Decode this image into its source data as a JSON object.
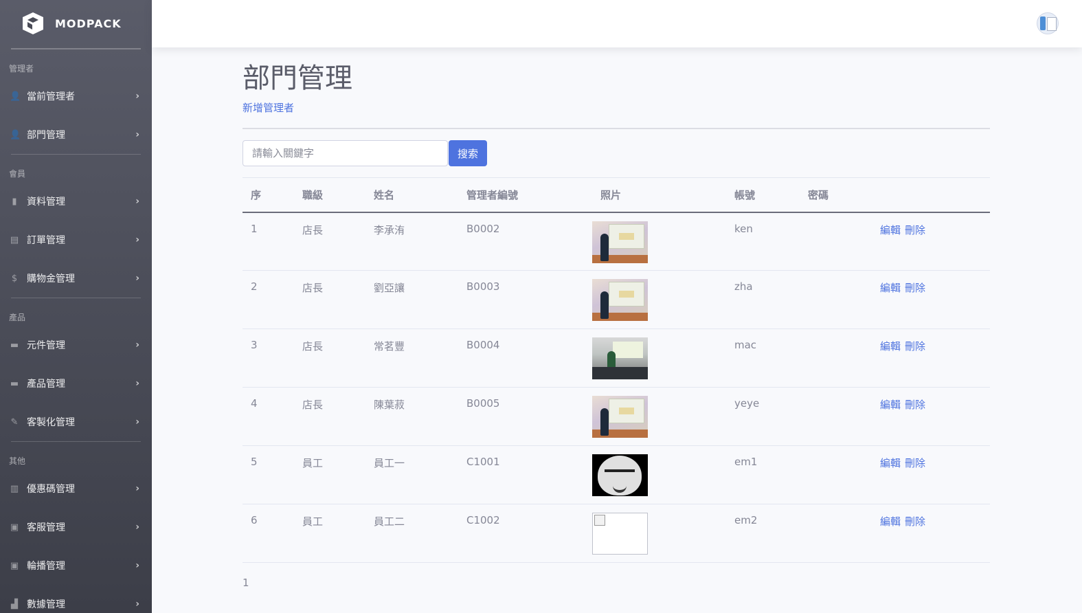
{
  "brand": {
    "name": "MODPACK",
    "icon": "cube-logo-icon"
  },
  "sidebar": {
    "sections": [
      {
        "heading": "管理者",
        "items": [
          {
            "label": "當前管理者",
            "icon": "user-icon",
            "glyph": "👤"
          },
          {
            "label": "部門管理",
            "icon": "user-icon",
            "glyph": "👤"
          }
        ]
      },
      {
        "heading": "會員",
        "items": [
          {
            "label": "資料管理",
            "icon": "file-icon",
            "glyph": "▮"
          },
          {
            "label": "訂單管理",
            "icon": "clipboard-icon",
            "glyph": "▤"
          },
          {
            "label": "購物金管理",
            "icon": "dollar-icon",
            "glyph": "$"
          }
        ]
      },
      {
        "heading": "產品",
        "items": [
          {
            "label": "元件管理",
            "icon": "box-icon",
            "glyph": "▬"
          },
          {
            "label": "產品管理",
            "icon": "box-icon",
            "glyph": "▬"
          },
          {
            "label": "客製化管理",
            "icon": "wrench-icon",
            "glyph": "✎"
          }
        ]
      },
      {
        "heading": "其他",
        "items": [
          {
            "label": "優惠碼管理",
            "icon": "barcode-icon",
            "glyph": "▥"
          },
          {
            "label": "客服管理",
            "icon": "id-card-icon",
            "glyph": "▣"
          },
          {
            "label": "輪播管理",
            "icon": "image-icon",
            "glyph": "▣"
          },
          {
            "label": "數據管理",
            "icon": "chart-bar-icon",
            "glyph": "▟"
          }
        ]
      }
    ]
  },
  "topbar": {
    "avatar_icon": "user-avatar-icon"
  },
  "page": {
    "title": "部門管理",
    "add_link": "新增管理者",
    "search_placeholder": "請輸入關鍵字",
    "search_button": "搜索",
    "pagination": "1"
  },
  "table": {
    "headers": [
      "序",
      "職級",
      "姓名",
      "管理者編號",
      "照片",
      "帳號",
      "密碼",
      ""
    ],
    "rows": [
      {
        "no": "1",
        "rank": "店長",
        "name": "李承洧",
        "id": "B0002",
        "photo": "slide",
        "account": "ken",
        "password": "",
        "edit": "編輯",
        "delete": "刪除"
      },
      {
        "no": "2",
        "rank": "店長",
        "name": "劉亞讓",
        "id": "B0003",
        "photo": "slide",
        "account": "zha",
        "password": "",
        "edit": "編輯",
        "delete": "刪除"
      },
      {
        "no": "3",
        "rank": "店長",
        "name": "常茗豐",
        "id": "B0004",
        "photo": "room",
        "account": "mac",
        "password": "",
        "edit": "編輯",
        "delete": "刪除"
      },
      {
        "no": "4",
        "rank": "店長",
        "name": "陳葉菽",
        "id": "B0005",
        "photo": "slide",
        "account": "yeye",
        "password": "",
        "edit": "編輯",
        "delete": "刪除"
      },
      {
        "no": "5",
        "rank": "員工",
        "name": "員工一",
        "id": "C1001",
        "photo": "mask",
        "account": "em1",
        "password": "",
        "edit": "編輯",
        "delete": "刪除"
      },
      {
        "no": "6",
        "rank": "員工",
        "name": "員工二",
        "id": "C1002",
        "photo": "broken",
        "account": "em2",
        "password": "",
        "edit": "編輯",
        "delete": "刪除"
      }
    ]
  }
}
